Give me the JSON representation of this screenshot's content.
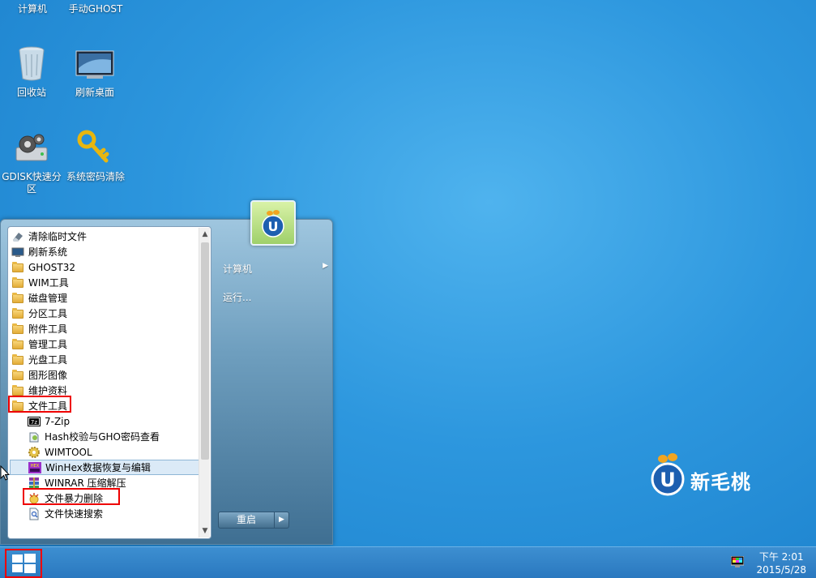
{
  "desktop": {
    "icons": [
      {
        "label": "计算机"
      },
      {
        "label": "手动GHOST"
      },
      {
        "label": "回收站"
      },
      {
        "label": "刷新桌面"
      },
      {
        "label": "GDISK快速分区"
      },
      {
        "label": "系统密码清除"
      }
    ]
  },
  "start_menu": {
    "programs": [
      {
        "label": "清除临时文件",
        "icon": "eraser-icon"
      },
      {
        "label": "刷新系统",
        "icon": "monitor-icon"
      },
      {
        "label": "GHOST32",
        "icon": "folder-icon"
      },
      {
        "label": "WIM工具",
        "icon": "folder-icon"
      },
      {
        "label": "磁盘管理",
        "icon": "folder-icon"
      },
      {
        "label": "分区工具",
        "icon": "folder-icon"
      },
      {
        "label": "附件工具",
        "icon": "folder-icon"
      },
      {
        "label": "管理工具",
        "icon": "folder-icon"
      },
      {
        "label": "光盘工具",
        "icon": "folder-icon"
      },
      {
        "label": "图形图像",
        "icon": "folder-icon"
      },
      {
        "label": "维护资料",
        "icon": "folder-icon"
      },
      {
        "label": "文件工具",
        "icon": "folder-icon"
      },
      {
        "label": "7-Zip",
        "icon": "7zip-icon"
      },
      {
        "label": "Hash校验与GHO密码查看",
        "icon": "hash-icon"
      },
      {
        "label": "WIMTOOL",
        "icon": "gear-icon"
      },
      {
        "label": "WinHex数据恢复与编辑",
        "icon": "winhex-icon"
      },
      {
        "label": "WINRAR 压缩解压",
        "icon": "winrar-icon"
      },
      {
        "label": "文件暴力删除",
        "icon": "force-delete-icon"
      },
      {
        "label": "文件快速搜索",
        "icon": "search-doc-icon"
      }
    ],
    "right": {
      "computer_label": "计算机",
      "run_label": "运行...",
      "restart_label": "重启"
    }
  },
  "taskbar": {
    "time": "下午 2:01",
    "date": "2015/5/28"
  },
  "brand": {
    "logo_text": "新毛桃",
    "logo_letter": "U"
  },
  "colors": {
    "desktop": "#2d97de",
    "highlight_box": "#ee0000",
    "selected_row": "#dbeaf7"
  }
}
